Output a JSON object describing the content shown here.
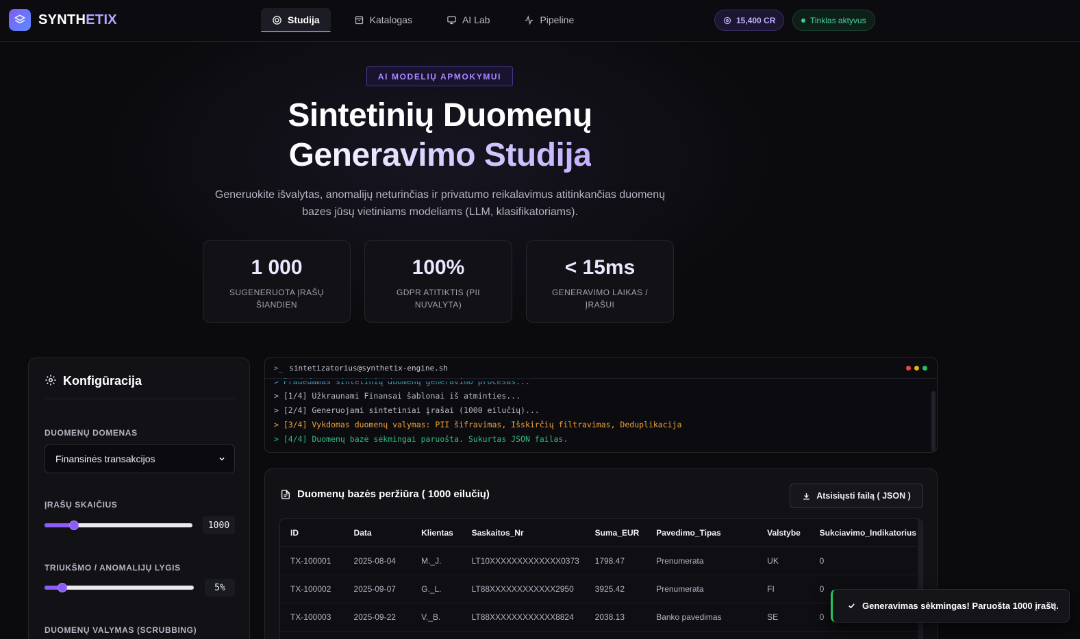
{
  "brand": {
    "name": "SYNTHETIX",
    "name_main": "SYNTH",
    "name_accent": "ETIX"
  },
  "nav": {
    "items": [
      {
        "label": "Studija",
        "icon": "target-icon",
        "active": true
      },
      {
        "label": "Katalogas",
        "icon": "archive-icon",
        "active": false
      },
      {
        "label": "AI Lab",
        "icon": "monitor-icon",
        "active": false
      },
      {
        "label": "Pipeline",
        "icon": "activity-icon",
        "active": false
      }
    ],
    "credits": "15,400 CR",
    "network_status": "Tinklas aktyvus"
  },
  "hero": {
    "badge": "AI MODELIŲ APMOKYMUI",
    "title_line1": "Sintetinių Duomenų",
    "title_line2": "Generavimo Studija",
    "subtitle": "Generuokite išvalytas, anomalijų neturinčias ir privatumo reikalavimus atitinkančias duomenų bazes jūsų vietiniams modeliams (LLM, klasifikatoriams)."
  },
  "stats": [
    {
      "value": "1 000",
      "label": "SUGENERUOTA ĮRAŠŲ ŠIANDIEN"
    },
    {
      "value": "100%",
      "label": "GDPR ATITIKTIS (PII NUVALYTA)"
    },
    {
      "value": "< 15ms",
      "label": "GENERAVIMO LAIKAS / ĮRAŠUI"
    }
  ],
  "config": {
    "title": "Konfigūracija",
    "domain_label": "DUOMENŲ DOMENAS",
    "domain_value": "Finansinės transakcijos",
    "records_label": "ĮRAŠŲ SKAIČIUS",
    "records_value": "1000",
    "records_fraction": 0.2,
    "noise_label": "TRIUKŠMO / ANOMALIJŲ LYGIS",
    "noise_value": "5%",
    "noise_fraction": 0.12,
    "scrubbing_label": "DUOMENŲ VALYMAS (SCRUBBING)"
  },
  "terminal": {
    "title": "sintetizatorius@synthetix-engine.sh",
    "lines": [
      {
        "text": "> Pradedamas sintetinių duomenų generavimo procesas...",
        "color": "#3aa6c9"
      },
      {
        "text": "> [1/4] Užkraunami Finansai šablonai iš atminties...",
        "color": "#b9b9c6"
      },
      {
        "text": "> [2/4] Generuojami sintetiniai įrašai (1000 eilučių)...",
        "color": "#b9b9c6"
      },
      {
        "text": "> [3/4] Vykdomas duomenų valymas: PII šifravimas, Išskirčių filtravimas, Deduplikacija",
        "color": "#f0a43a"
      },
      {
        "text": "> [4/4] Duomenų bazė sėkmingai paruošta. Sukurtas JSON failas.",
        "color": "#2fbf7f"
      }
    ]
  },
  "preview": {
    "title": "Duomenų bazės peržiūra ( 1000 eilučių)",
    "download_label": "Atsisiųsti failą ( JSON )",
    "columns": [
      "ID",
      "Data",
      "Klientas",
      "Saskaitos_Nr",
      "Suma_EUR",
      "Pavedimo_Tipas",
      "Valstybe",
      "Sukciavimo_Indikatorius"
    ],
    "rows": [
      [
        "TX-100001",
        "2025-08-04",
        "M._J.",
        "LT10XXXXXXXXXXXXX0373",
        "1798.47",
        "Prenumerata",
        "UK",
        "0"
      ],
      [
        "TX-100002",
        "2025-09-07",
        "G._L.",
        "LT88XXXXXXXXXXXX2950",
        "3925.42",
        "Prenumerata",
        "FI",
        "0"
      ],
      [
        "TX-100003",
        "2025-09-22",
        "V._B.",
        "LT88XXXXXXXXXXXX8824",
        "2038.13",
        "Banko pavedimas",
        "SE",
        "0"
      ]
    ]
  },
  "toast": {
    "message": "Generavimas sėkmingas! Paruošta 1000 įrašų."
  }
}
